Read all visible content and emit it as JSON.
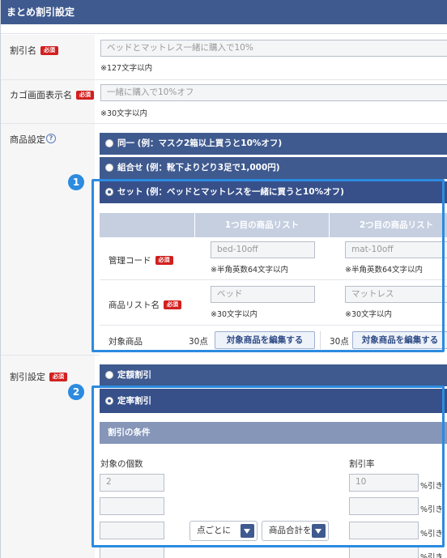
{
  "header": {
    "title": "まとめ割引設定"
  },
  "discount_name": {
    "label": "割引名",
    "required": "必須",
    "value": "ベッドとマットレス一緒に購入で10%",
    "note": "※127文字以内"
  },
  "cart_display_name": {
    "label": "カゴ画面表示名",
    "required": "必須",
    "value": "一緒に購入で10%オフ",
    "note": "※30文字以内"
  },
  "product_settings": {
    "label": "商品設定",
    "help_icon": "?",
    "options": [
      {
        "label": "同一 (例：マスク2箱以上買うと10%オフ)",
        "selected": false
      },
      {
        "label": "組合せ (例：靴下よりどり3足で1,000円)",
        "selected": false
      },
      {
        "label": "セット (例：ベッドとマットレスを一緒に買うと10%オフ)",
        "selected": true
      }
    ],
    "table": {
      "headers": [
        "1つ目の商品リスト",
        "2つ目の商品リスト"
      ],
      "management_code": {
        "label": "管理コード",
        "required": "必須",
        "values": [
          "bed-10off",
          "mat-10off"
        ],
        "note": "※半角英数64文字以内"
      },
      "list_name": {
        "label": "商品リスト名",
        "required": "必須",
        "values": [
          "ベッド",
          "マットレス"
        ],
        "note": "※30文字以内"
      },
      "target": {
        "label": "対象商品",
        "counts": [
          "30点",
          "30点"
        ],
        "button": "対象商品を編集する"
      }
    }
  },
  "discount_settings": {
    "label": "割引設定",
    "required": "必須",
    "options": [
      {
        "label": "定額割引",
        "selected": false
      },
      {
        "label": "定率割引",
        "selected": true
      }
    ],
    "conditions": {
      "title": "割引の条件",
      "count_label": "対象の個数",
      "rate_label": "割引率",
      "count_values": [
        "2",
        "",
        "",
        ""
      ],
      "rate_values": [
        "10",
        "",
        "",
        ""
      ],
      "rate_suffix": "%引き",
      "per_select": "点ごとに",
      "total_select": "商品合計を"
    }
  },
  "callouts": [
    "1",
    "2"
  ],
  "colors": {
    "header": "#3f5a8f",
    "callout": "#2c8be0",
    "required": "#d21f1f"
  }
}
